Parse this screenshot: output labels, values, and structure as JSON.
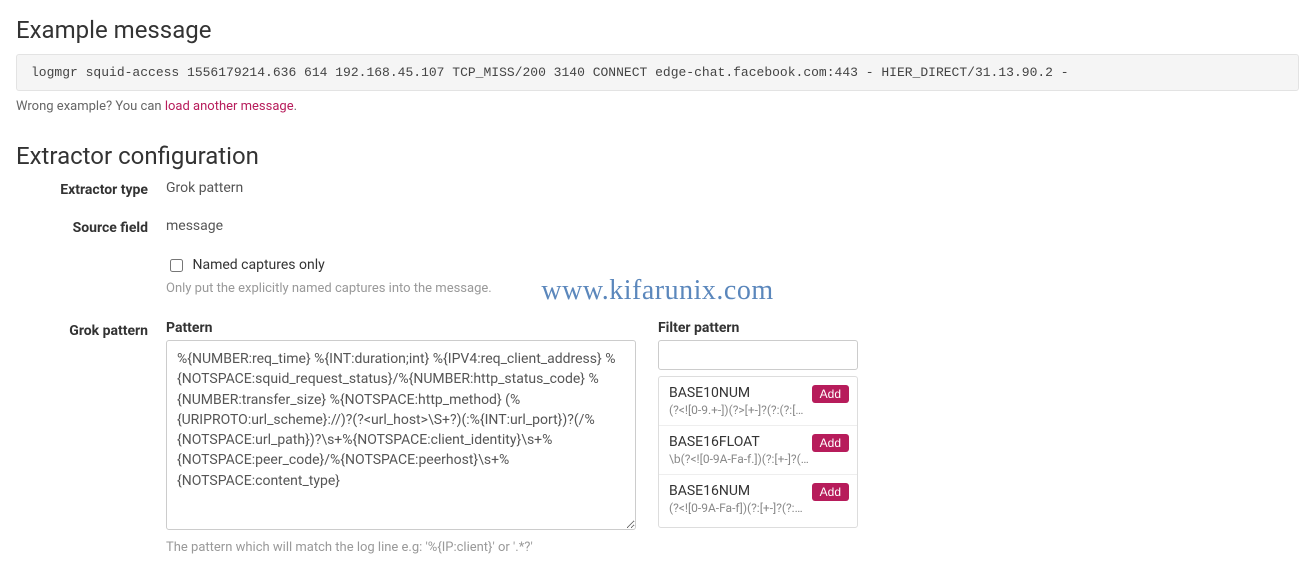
{
  "example": {
    "heading": "Example message",
    "message": "logmgr squid-access 1556179214.636 614 192.168.45.107 TCP_MISS/200 3140 CONNECT edge-chat.facebook.com:443 - HIER_DIRECT/31.13.90.2 -",
    "wrong_prefix": "Wrong example? You can ",
    "load_link": "load another message",
    "wrong_suffix": "."
  },
  "config": {
    "heading": "Extractor configuration",
    "extractor_type_label": "Extractor type",
    "extractor_type_value": "Grok pattern",
    "source_field_label": "Source field",
    "source_field_value": "message",
    "named_captures_label": "Named captures only",
    "named_captures_help": "Only put the explicitly named captures into the message.",
    "grok_pattern_label": "Grok pattern",
    "pattern_sub_label": "Pattern",
    "pattern_value": "%{NUMBER:req_time} %{INT:duration;int} %{IPV4:req_client_address} %{NOTSPACE:squid_request_status}/%{NUMBER:http_status_code} %{NUMBER:transfer_size} %{NOTSPACE:http_method} (%{URIPROTO:url_scheme}://)?(?<url_host>\\S+?)(:%{INT:url_port})?(/%{NOTSPACE:url_path})?\\s+%{NOTSPACE:client_identity}\\s+%{NOTSPACE:peer_code}/%{NOTSPACE:peerhost}\\s+%{NOTSPACE:content_type}",
    "pattern_help": "The pattern which will match the log line e.g: '%{IP:client}' or '.*?'",
    "filter_label": "Filter pattern",
    "filter_value": "",
    "add_label": "Add",
    "patterns": [
      {
        "name": "BASE10NUM",
        "regex": "(?<![0-9.+-])(?>[+-]?(?:(?:[0-9]..."
      },
      {
        "name": "BASE16FLOAT",
        "regex": "\\b(?<![0-9A-Fa-f.])(?:[+-]?(?:0..."
      },
      {
        "name": "BASE16NUM",
        "regex": "(?<![0-9A-Fa-f])(?:[+-]?(?:0x)?(..."
      }
    ]
  },
  "watermark": "www.kifarunix.com"
}
